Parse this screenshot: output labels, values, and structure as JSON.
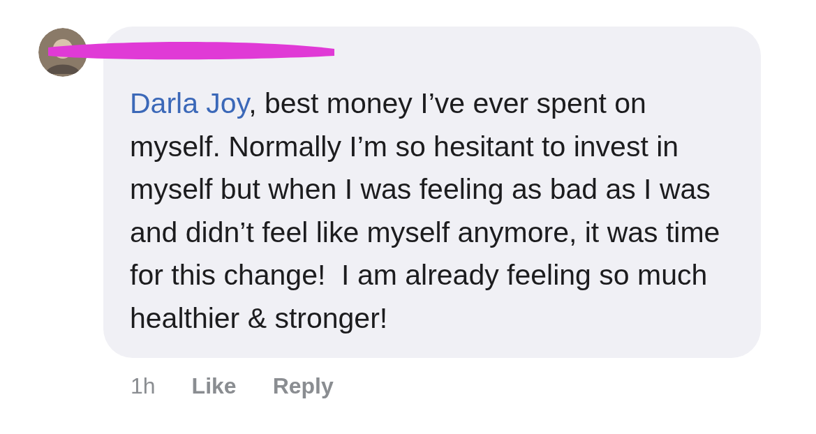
{
  "comment": {
    "author_hidden": true,
    "mention": "Darla Joy",
    "text": ", best money I’ve ever spent on myself. Normally I’m so hesitant to invest in myself but when I was feeling as bad as I was and didn’t feel like myself anymore, it was time for this change!  I am already feeling so much healthier & stronger!",
    "time": "1h",
    "actions": [
      "Like",
      "Reply"
    ]
  }
}
